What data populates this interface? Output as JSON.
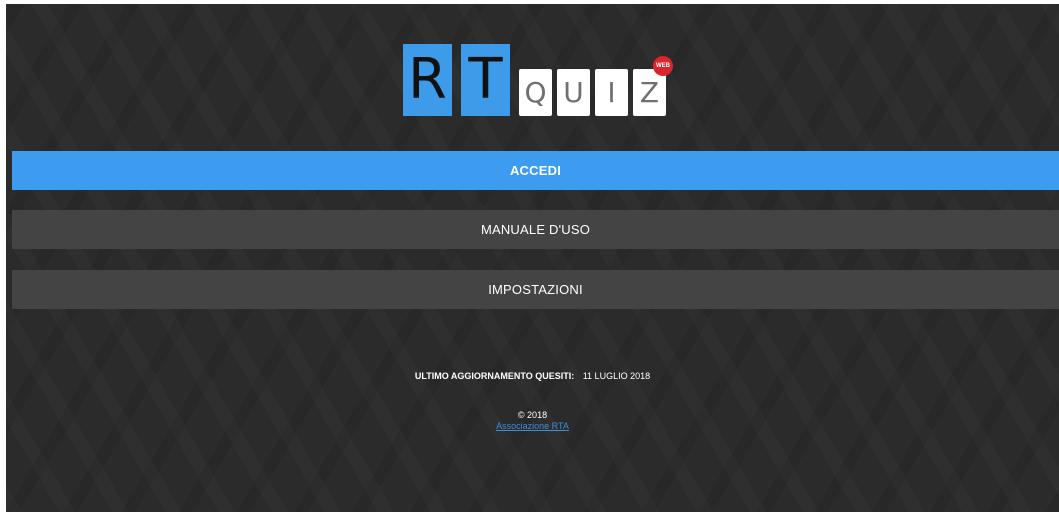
{
  "logo": {
    "tiles_big": [
      "R",
      "T"
    ],
    "tiles_small": [
      "Q",
      "U",
      "I",
      "Z"
    ],
    "badge": "WEB"
  },
  "menu": {
    "login_label": "ACCEDI",
    "manual_label": "MANUALE D'USO",
    "settings_label": "IMPOSTAZIONI"
  },
  "footer": {
    "update_label": "ULTIMO AGGIORNAMENTO QUESITI:",
    "update_date": "11 LUGLIO 2018",
    "copyright": "© 2018",
    "association_link": "Associazione RTA"
  },
  "colors": {
    "accent": "#3d9bf0",
    "background": "#2b2b2b",
    "secondary_button": "#444444",
    "badge": "#d9262b"
  }
}
